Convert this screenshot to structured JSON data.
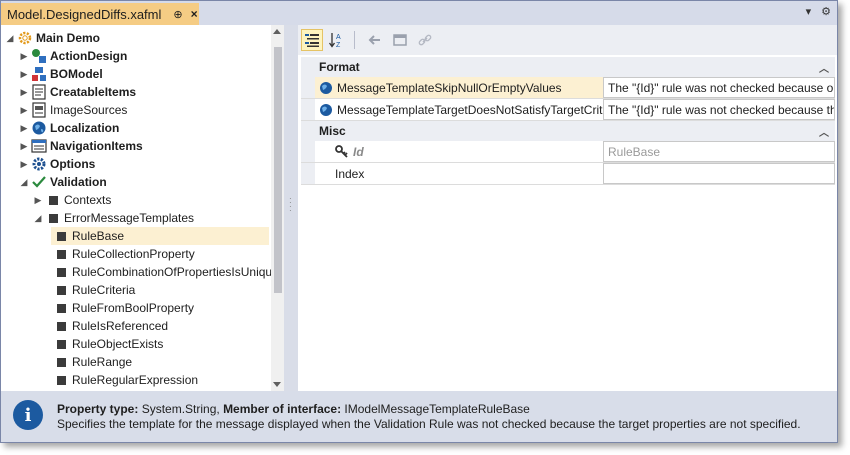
{
  "tab": {
    "title": "Model.DesignedDiffs.xafml",
    "pin_glyph": "⊕",
    "close_glyph": "×"
  },
  "titlebar_right": {
    "dropdown_glyph": "▾",
    "settings_glyph": "⚙"
  },
  "tree": {
    "items": [
      {
        "label": "Main Demo",
        "expander": "◢",
        "icon": "gear-icon"
      },
      {
        "label": "ActionDesign",
        "expander": "▶",
        "icon": "action-design-icon"
      },
      {
        "label": "BOModel",
        "expander": "▶",
        "icon": "bomodel-icon"
      },
      {
        "label": "CreatableItems",
        "expander": "▶",
        "icon": "creatable-items-icon"
      },
      {
        "label": "ImageSources",
        "expander": "▶",
        "icon": "image-sources-icon"
      },
      {
        "label": "Localization",
        "expander": "▶",
        "icon": "globe-icon"
      },
      {
        "label": "NavigationItems",
        "expander": "▶",
        "icon": "navigation-icon"
      },
      {
        "label": "Options",
        "expander": "▶",
        "icon": "options-gear-icon"
      },
      {
        "label": "Validation",
        "expander": "◢",
        "icon": "checkmark-icon"
      },
      {
        "label": "Contexts",
        "expander": "▶",
        "icon": "node-square-icon"
      },
      {
        "label": "ErrorMessageTemplates",
        "expander": "◢",
        "icon": "node-square-icon"
      },
      {
        "label": "RuleBase",
        "expander": "",
        "icon": "node-square-icon"
      },
      {
        "label": "RuleCollectionProperty",
        "expander": "",
        "icon": "node-square-icon"
      },
      {
        "label": "RuleCombinationOfPropertiesIsUnique",
        "expander": "",
        "icon": "node-square-icon"
      },
      {
        "label": "RuleCriteria",
        "expander": "",
        "icon": "node-square-icon"
      },
      {
        "label": "RuleFromBoolProperty",
        "expander": "",
        "icon": "node-square-icon"
      },
      {
        "label": "RuleIsReferenced",
        "expander": "",
        "icon": "node-square-icon"
      },
      {
        "label": "RuleObjectExists",
        "expander": "",
        "icon": "node-square-icon"
      },
      {
        "label": "RuleRange",
        "expander": "",
        "icon": "node-square-icon"
      },
      {
        "label": "RuleRegularExpression",
        "expander": "",
        "icon": "node-square-icon"
      }
    ],
    "selected": "RuleBase"
  },
  "toolbar": {
    "categorized_icon": "categorized-icon",
    "alphabetical_icon": "sort-alphabetical-icon",
    "reset_icon": "reset-icon",
    "navigate_icon": "navigate-icon",
    "link_icon": "link-icon"
  },
  "grid": {
    "cat_format": "Format",
    "cat_misc": "Misc",
    "collapse_glyph": "︿",
    "format_rows": [
      {
        "name": "MessageTemplateSkipNullOrEmptyValues",
        "value": "The \"{Id}\" rule was not checked because on..."
      },
      {
        "name": "MessageTemplateTargetDoesNotSatisfyTargetCriteria",
        "value": "The \"{Id}\" rule was not checked because the..."
      }
    ],
    "misc_rows": [
      {
        "name": "Id",
        "value": "RuleBase"
      },
      {
        "name": "Index",
        "value": ""
      }
    ]
  },
  "info": {
    "icon": "i",
    "type_label": "Property type:",
    "type_value": " System.String, ",
    "member_label": "Member of interface:",
    "member_value": " IModelMessageTemplateRuleBase",
    "description": "Specifies the template for the message displayed when the Validation Rule was not checked because the target properties are not specified."
  },
  "colors": {
    "tab_active": "#f5cc84",
    "selection": "#fcf0d2",
    "panel": "#d8dde9",
    "info_icon": "#1c5aa0"
  }
}
